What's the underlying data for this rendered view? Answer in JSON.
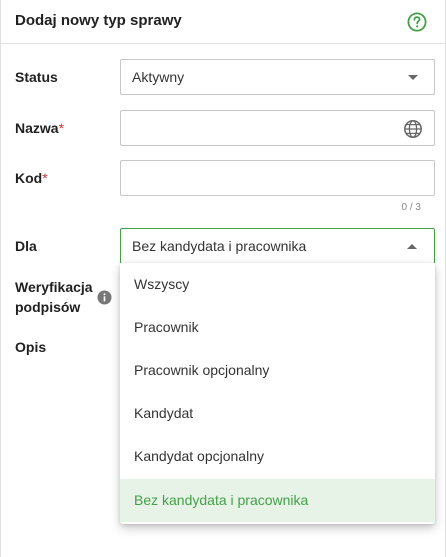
{
  "header": {
    "title": "Dodaj nowy typ sprawy"
  },
  "form": {
    "status": {
      "label": "Status",
      "value": "Aktywny"
    },
    "name": {
      "label": "Nazwa",
      "required_mark": "*",
      "value": ""
    },
    "code": {
      "label": "Kod",
      "required_mark": "*",
      "value": "",
      "counter": "0 / 3"
    },
    "for": {
      "label": "Dla",
      "value": "Bez kandydata i pracownika"
    },
    "signature_verification": {
      "label_line1": "Weryfikacja",
      "label_line2": "podpisów"
    },
    "description": {
      "label": "Opis"
    }
  },
  "dropdown": {
    "options": [
      {
        "label": "Wszyscy"
      },
      {
        "label": "Pracownik"
      },
      {
        "label": "Pracownik opcjonalny"
      },
      {
        "label": "Kandydat"
      },
      {
        "label": "Kandydat opcjonalny"
      },
      {
        "label": "Bez kandydata i pracownika",
        "selected": true
      }
    ]
  },
  "colors": {
    "accent": "#43a047",
    "required": "#d32f2f",
    "selected_bg": "#e8f3e8"
  },
  "icons": {
    "help": "question-circle-icon",
    "globe": "globe-icon",
    "info": "info-icon",
    "select_caret": "caret-down-icon",
    "open_caret": "caret-up-icon"
  }
}
